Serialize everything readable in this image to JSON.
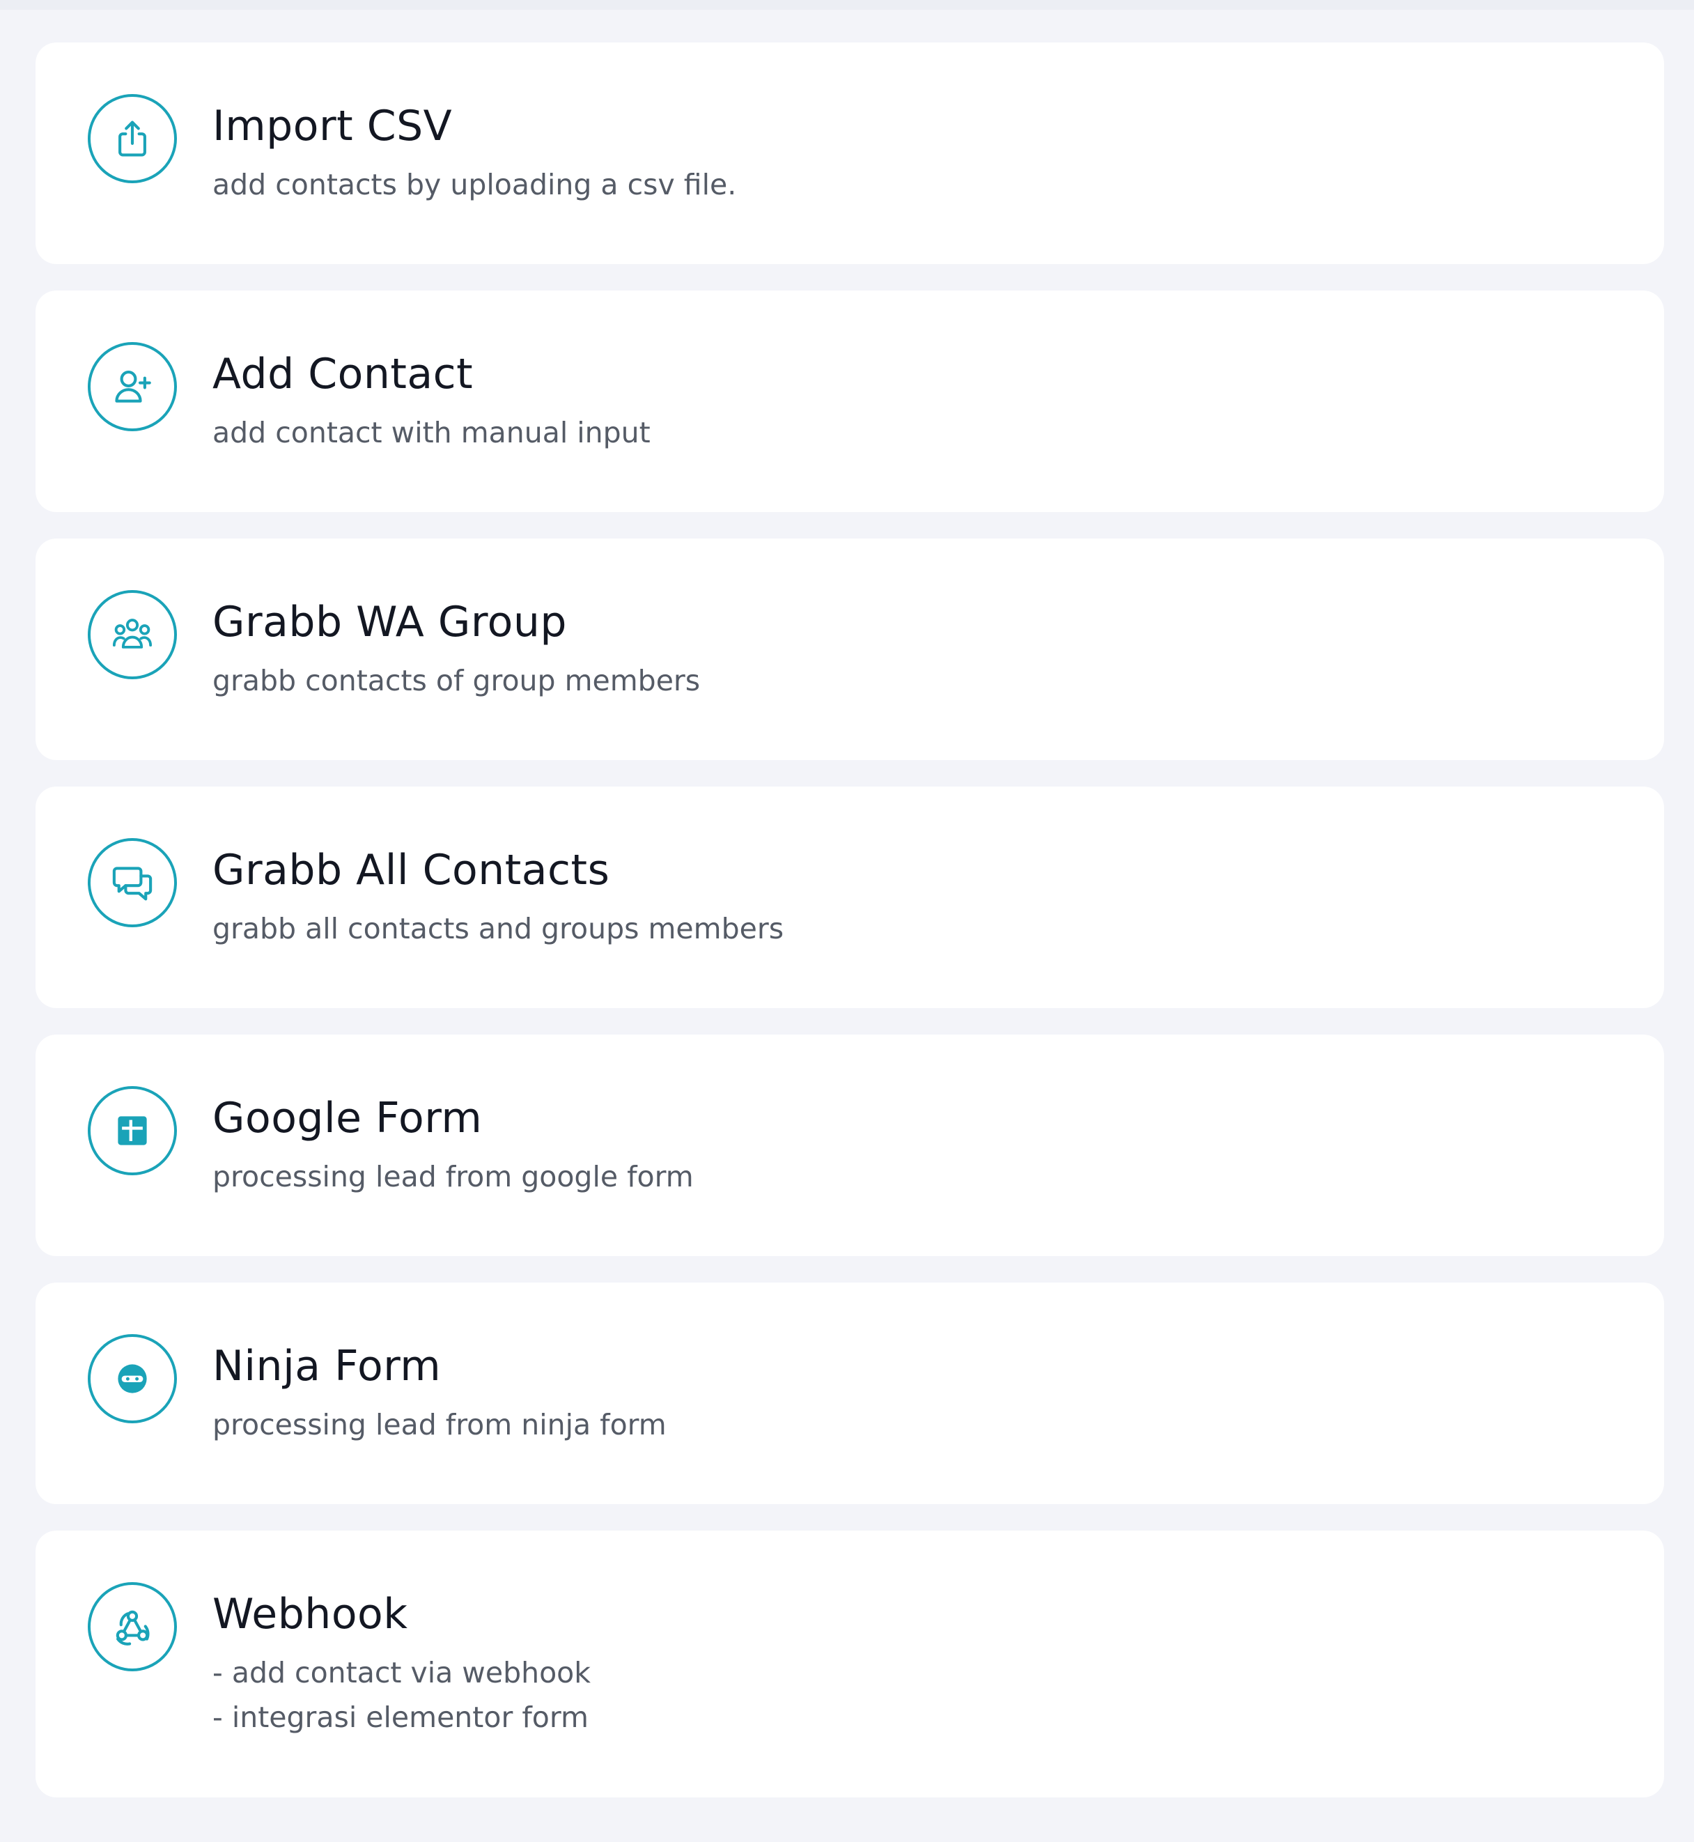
{
  "theme": {
    "accent": "#1aa3b8",
    "card_bg": "#ffffff",
    "page_bg": "#f3f4f9",
    "title_color": "#131722",
    "desc_color": "#555b66"
  },
  "options": [
    {
      "icon": "upload-icon",
      "title": "Import CSV",
      "description": [
        "add contacts by uploading a csv file."
      ]
    },
    {
      "icon": "add-user-icon",
      "title": "Add Contact",
      "description": [
        "add contact with manual input"
      ]
    },
    {
      "icon": "group-icon",
      "title": "Grabb WA Group",
      "description": [
        "grabb contacts of group members"
      ]
    },
    {
      "icon": "chat-bubbles-icon",
      "title": "Grabb All Contacts",
      "description": [
        "grabb all contacts and groups members"
      ]
    },
    {
      "icon": "google-form-icon",
      "title": "Google Form",
      "description": [
        "processing lead from google form"
      ]
    },
    {
      "icon": "ninja-icon",
      "title": "Ninja Form",
      "description": [
        "processing lead from ninja form"
      ]
    },
    {
      "icon": "webhook-icon",
      "title": "Webhook",
      "description": [
        "- add contact via webhook",
        "- integrasi elementor form"
      ]
    }
  ]
}
